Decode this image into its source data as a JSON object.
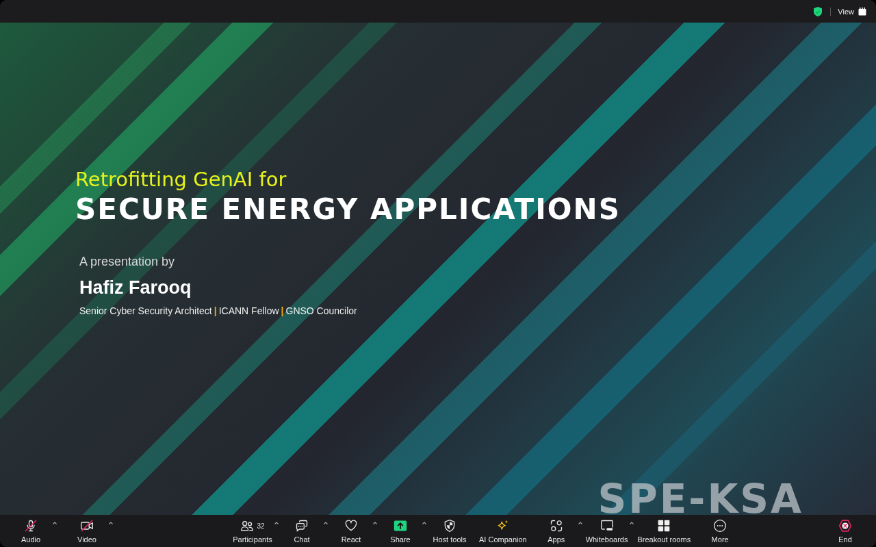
{
  "top_bar": {
    "view_button": {
      "label": "View"
    }
  },
  "slide": {
    "subtitle": "Retrofitting GenAI for",
    "title": "SECURE ENERGY APPLICATIONS",
    "byline": "A presentation by",
    "presenter": "Hafiz Farooq",
    "roles": [
      "Senior Cyber Security Architect",
      "ICANN Fellow",
      "GNSO Councilor"
    ],
    "separator": "|",
    "logo_text": "SPE-KSA"
  },
  "toolbar": {
    "left": [
      {
        "kind": "audio",
        "label": "Audio",
        "menu": true,
        "muted": true
      },
      {
        "kind": "video",
        "label": "Video",
        "menu": true,
        "muted": true
      }
    ],
    "center": [
      {
        "kind": "participants",
        "label": "Participants",
        "menu": true,
        "count": "32"
      },
      {
        "kind": "chat",
        "label": "Chat",
        "menu": true
      },
      {
        "kind": "react",
        "label": "React",
        "menu": true
      },
      {
        "kind": "share",
        "label": "Share",
        "menu": true
      },
      {
        "kind": "host-tools",
        "label": "Host tools",
        "menu": false
      },
      {
        "kind": "ai-companion",
        "label": "AI Companion",
        "menu": false
      },
      {
        "kind": "apps",
        "label": "Apps",
        "menu": true
      },
      {
        "kind": "whiteboards",
        "label": "Whiteboards",
        "menu": true
      },
      {
        "kind": "breakout-rooms",
        "label": "Breakout rooms",
        "menu": false
      },
      {
        "kind": "more",
        "label": "More",
        "menu": false
      }
    ],
    "right": [
      {
        "kind": "end",
        "label": "End",
        "menu": false
      }
    ]
  }
}
